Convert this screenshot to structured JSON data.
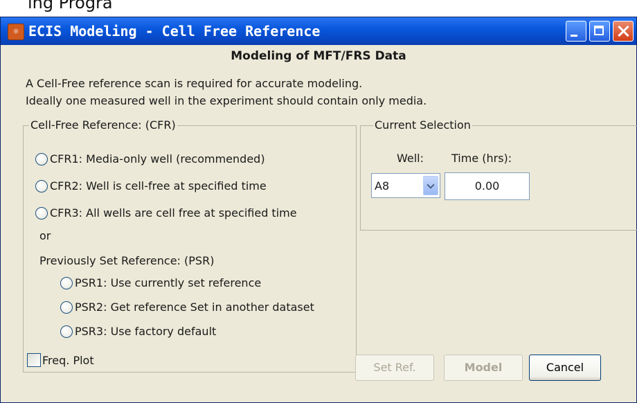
{
  "caption": "ing Progra",
  "window": {
    "title": "ECIS Modeling - Cell Free Reference",
    "icon": "ecis-app-icon"
  },
  "dialog": {
    "heading": "Modeling of MFT/FRS Data",
    "intro_line1": "A Cell-Free reference scan is required for accurate modeling.",
    "intro_line2": "Ideally one measured well in the experiment should contain only media."
  },
  "cfr_group": {
    "legend": "Cell-Free Reference: (CFR)",
    "options": [
      {
        "label": "CFR1: Media-only well (recommended)",
        "selected": false
      },
      {
        "label": "CFR2: Well is cell-free at specified time",
        "selected": false
      },
      {
        "label": "CFR3: All wells are cell free at specified time",
        "selected": false
      }
    ],
    "or_text": "or",
    "psr_heading": "Previously Set Reference: (PSR)",
    "psr_options": [
      {
        "label": "PSR1: Use currently set reference",
        "selected": false
      },
      {
        "label": "PSR2: Get reference Set in another dataset",
        "selected": false
      },
      {
        "label": "PSR3: Use factory default",
        "selected": false
      }
    ]
  },
  "current_selection": {
    "legend": "Current Selection",
    "well_label": "Well:",
    "time_label": "Time (hrs):",
    "well_value": "A8",
    "time_value": "0.00"
  },
  "footer": {
    "freq_plot_label": "Freq. Plot",
    "freq_plot_checked": false,
    "set_ref_label": "Set Ref.",
    "model_label": "Model",
    "cancel_label": "Cancel"
  },
  "colors": {
    "titlebar": "#0a58dd",
    "dialog_bg": "#ece9d8",
    "disabled_text": "#aca899"
  }
}
